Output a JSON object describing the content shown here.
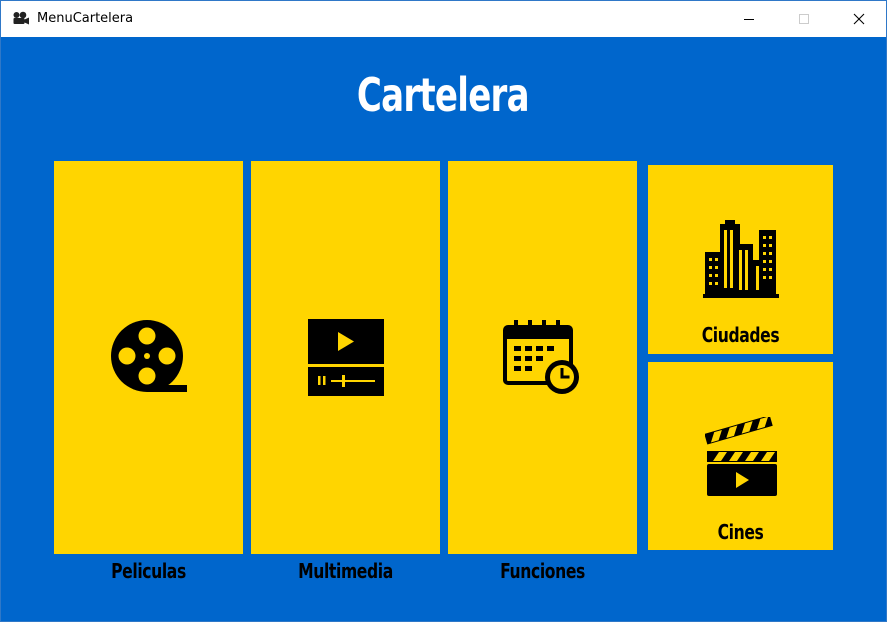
{
  "window": {
    "title": "MenuCartelera",
    "app_icon": "film-camera-icon",
    "controls": [
      "minimize-icon",
      "maximize-icon",
      "close-icon"
    ]
  },
  "main": {
    "heading": "Cartelera",
    "tiles": [
      {
        "label": "Peliculas",
        "icon": "film-reel-icon"
      },
      {
        "label": "Multimedia",
        "icon": "media-player-icon"
      },
      {
        "label": "Funciones",
        "icon": "calendar-clock-icon"
      },
      {
        "label": "Ciudades",
        "icon": "city-buildings-icon"
      },
      {
        "label": "Cines",
        "icon": "clapperboard-icon"
      }
    ]
  },
  "colors": {
    "background": "#0066cc",
    "tile": "#ffd500",
    "heading": "#ffffff",
    "text": "#000000"
  }
}
